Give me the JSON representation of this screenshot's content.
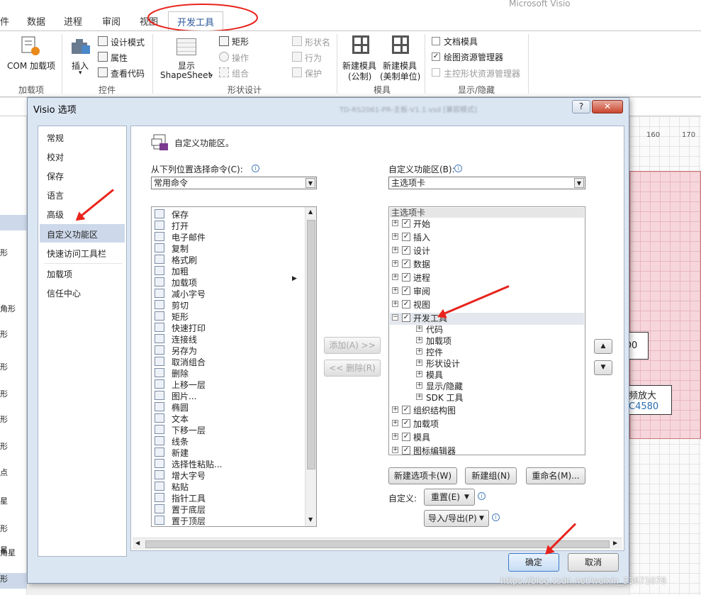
{
  "app": {
    "name": "Microsoft Visio"
  },
  "ribbon": {
    "tabs": [
      {
        "label": "件"
      },
      {
        "label": "数据"
      },
      {
        "label": "进程"
      },
      {
        "label": "审阅"
      },
      {
        "label": "视图"
      },
      {
        "label": "开发工具"
      }
    ],
    "groups": {
      "addins": {
        "label": "加载项",
        "com_label": "COM 加载项"
      },
      "controls": {
        "label": "控件",
        "insert_label": "插入",
        "design_mode": "设计模式",
        "properties": "属性",
        "view_code": "查看代码"
      },
      "shape_design": {
        "label": "形状设计",
        "show_label": "显示",
        "shapesheet_label": "ShapeSheet",
        "rectangle": "矩形",
        "operation": "操作",
        "combine": "组合",
        "shape_name": "形状名",
        "behavior": "行为",
        "protect": "保护"
      },
      "stencil": {
        "label": "模具",
        "new_stencil_us": "新建模具",
        "us_sub": "(公制)",
        "new_stencil_metric": "新建模具",
        "metric_sub": "(美制单位)"
      },
      "show_hide": {
        "label": "显示/隐藏",
        "document_stencil": "文档模具",
        "drawing_explorer": "绘图资源管理器",
        "master_explorer": "主控形状资源管理器"
      }
    }
  },
  "canvas": {
    "ruler_160": "160",
    "ruler_170": "170",
    "shape_d0": "D0",
    "shape_amp": "频放大",
    "shape_c4580": "C4580",
    "left_shapes": [
      "形",
      "角形",
      "形",
      "形",
      "形",
      "形",
      "形",
      "点",
      "星",
      "形",
      "星",
      "角星",
      "形"
    ]
  },
  "dialog": {
    "title": "Visio 选项",
    "title_blurred": "TD-RS2061-PR-主板-V1.1.vsd  [兼容模式]",
    "help_button": "?",
    "close_button": "✕",
    "nav": [
      "常规",
      "校对",
      "保存",
      "语言",
      "高级",
      "自定义功能区",
      "快速访问工具栏",
      "加载项",
      "信任中心"
    ],
    "section_title": "自定义功能区。",
    "choose_commands_label": "从下列位置选择命令(C):",
    "choose_commands_value": "常用命令",
    "customize_ribbon_label": "自定义功能区(B):",
    "customize_ribbon_value": "主选项卡",
    "commands": [
      "保存",
      "打开",
      "电子邮件",
      "复制",
      "格式刷",
      "加粗",
      "加载项",
      "减小字号",
      "剪切",
      "矩形",
      "快速打印",
      "连接线",
      "另存为",
      "取消组合",
      "删除",
      "上移一层",
      "图片...",
      "椭圆",
      "文本",
      "下移一层",
      "线条",
      "新建",
      "选择性粘贴...",
      "增大字号",
      "粘贴",
      "指针工具",
      "置于底层",
      "置于顶层"
    ],
    "add_button": "添加(A) >>",
    "remove_button": "<< 删除(R)",
    "tree_header": "主选项卡",
    "tree": [
      {
        "label": "开始",
        "checked": "✓",
        "expander": "+"
      },
      {
        "label": "插入",
        "checked": "✓",
        "expander": "+"
      },
      {
        "label": "设计",
        "checked": "✓",
        "expander": "+"
      },
      {
        "label": "数据",
        "checked": "✓",
        "expander": "+"
      },
      {
        "label": "进程",
        "checked": "✓",
        "expander": "+"
      },
      {
        "label": "审阅",
        "checked": "✓",
        "expander": "+"
      },
      {
        "label": "视图",
        "checked": "✓",
        "expander": "+"
      },
      {
        "label": "开发工具",
        "checked": "✓",
        "expander": "−"
      }
    ],
    "dev_children": [
      "代码",
      "加载项",
      "控件",
      "形状设计",
      "模具",
      "显示/隐藏",
      "SDK 工具"
    ],
    "tree_after": [
      {
        "label": "组织结构图",
        "checked": "✓",
        "expander": "+"
      },
      {
        "label": "加载项",
        "checked": "✓",
        "expander": "+"
      },
      {
        "label": "模具",
        "checked": "✓",
        "expander": "+"
      },
      {
        "label": "图标编辑器",
        "checked": "✓",
        "expander": "+"
      }
    ],
    "new_tab_button": "新建选项卡(W)",
    "new_group_button": "新建组(N)",
    "rename_button": "重命名(M)...",
    "customize_label": "自定义:",
    "reset_button": "重置(E)",
    "import_export_button": "导入/导出(P)",
    "ok_button": "确定",
    "cancel_button": "取消",
    "move_up": "▲",
    "move_down": "▼"
  },
  "watermark": "https://blog.csdn.net/weixin_33671078",
  "colors": {
    "annotation_red": "#e8231c",
    "dialog_bg": "#dbe6f3",
    "nav_selected": "#cdd9ea",
    "tab_active_text": "#2b579a"
  }
}
